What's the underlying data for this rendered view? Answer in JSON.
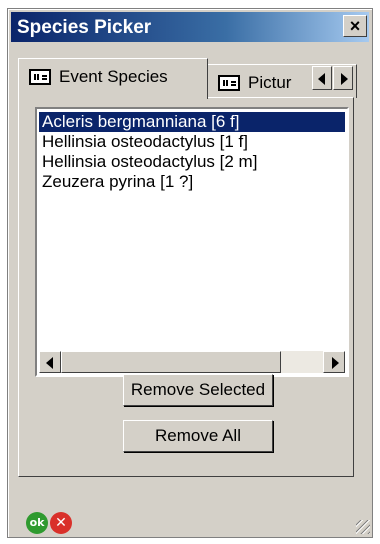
{
  "window": {
    "title": "Species Picker",
    "close_label": "×"
  },
  "tabs": [
    {
      "label": "Event Species",
      "icon": "list-view-icon",
      "active": true
    },
    {
      "label": "Pictur",
      "icon": "list-view-icon",
      "active": false
    }
  ],
  "species_list": {
    "selected_index": 0,
    "items": [
      "Acleris bergmanniana [6 f]",
      "Hellinsia osteodactylus [1 f]",
      "Hellinsia osteodactylus [2 m]",
      "Zeuzera pyrina [1 ?]"
    ]
  },
  "buttons": {
    "remove_selected": "Remove Selected",
    "remove_all": "Remove All"
  },
  "status": {
    "ok_label": "ok",
    "cancel_label": "✕"
  },
  "colors": {
    "selection": "#0a246a",
    "title_bar": "#0a246a",
    "ok": "#2f9a2f",
    "cancel": "#d9302a",
    "face": "#d4d0c8"
  }
}
